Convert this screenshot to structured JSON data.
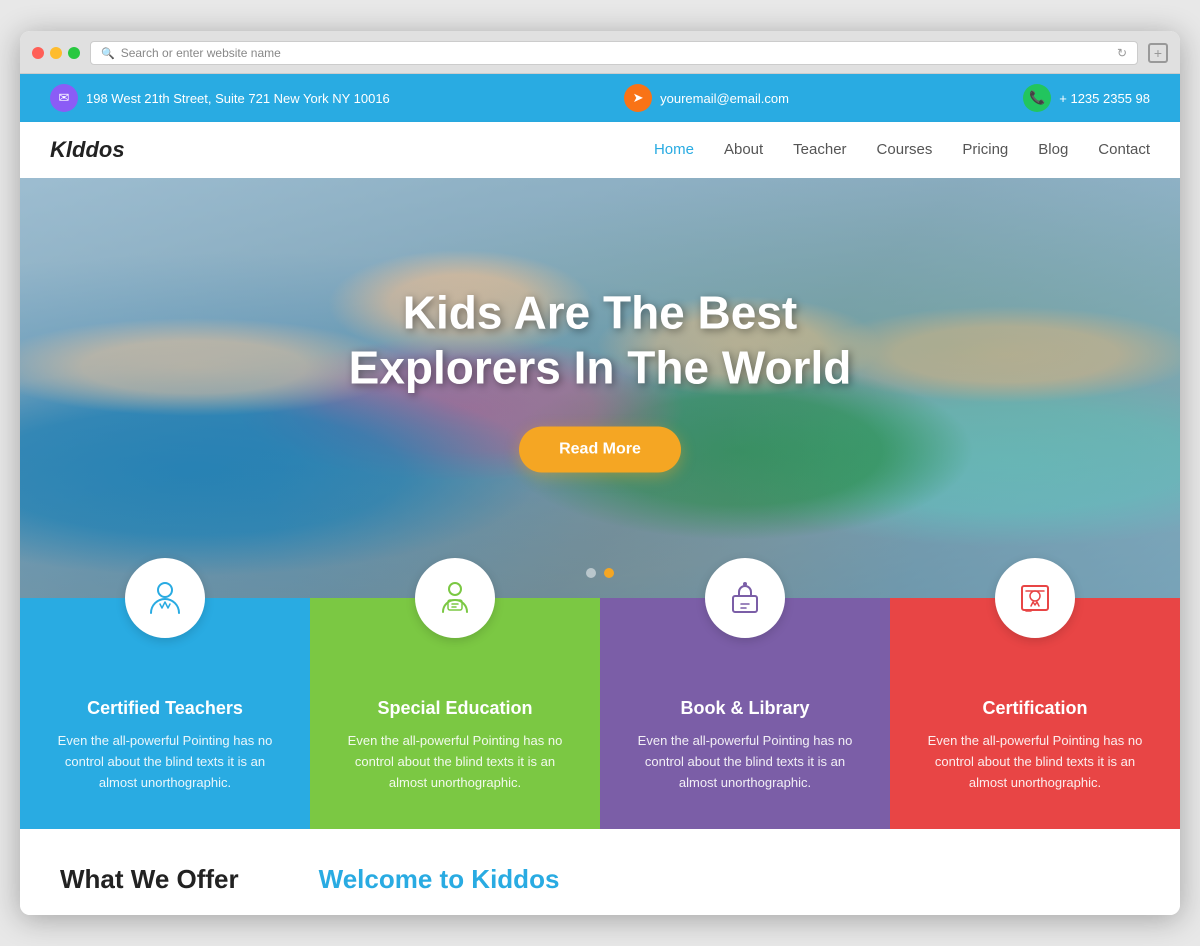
{
  "browser": {
    "address_placeholder": "Search or enter website name"
  },
  "topbar": {
    "address": "198 West 21th Street, Suite 721 New York NY 10016",
    "email": "youremail@email.com",
    "phone": "+ 1235 2355 98"
  },
  "nav": {
    "logo": "Klddos",
    "links": [
      {
        "label": "Home",
        "active": true
      },
      {
        "label": "About",
        "active": false
      },
      {
        "label": "Teacher",
        "active": false
      },
      {
        "label": "Courses",
        "active": false
      },
      {
        "label": "Pricing",
        "active": false
      },
      {
        "label": "Blog",
        "active": false
      },
      {
        "label": "Contact",
        "active": false
      }
    ]
  },
  "hero": {
    "title_line1": "Kids Are The Best",
    "title_line2": "Explorers In The World",
    "button_label": "Read More"
  },
  "features": [
    {
      "title": "Certified Teachers",
      "text": "Even the all-powerful Pointing has no control about the blind texts it is an almost unorthographic."
    },
    {
      "title": "Special Education",
      "text": "Even the all-powerful Pointing has no control about the blind texts it is an almost unorthographic."
    },
    {
      "title": "Book & Library",
      "text": "Even the all-powerful Pointing has no control about the blind texts it is an almost unorthographic."
    },
    {
      "title": "Certification",
      "text": "Even the all-powerful Pointing has no control about the blind texts it is an almost unorthographic."
    }
  ],
  "bottom": {
    "section1": "What We Offer",
    "section2": "Welcome to Kiddos"
  }
}
